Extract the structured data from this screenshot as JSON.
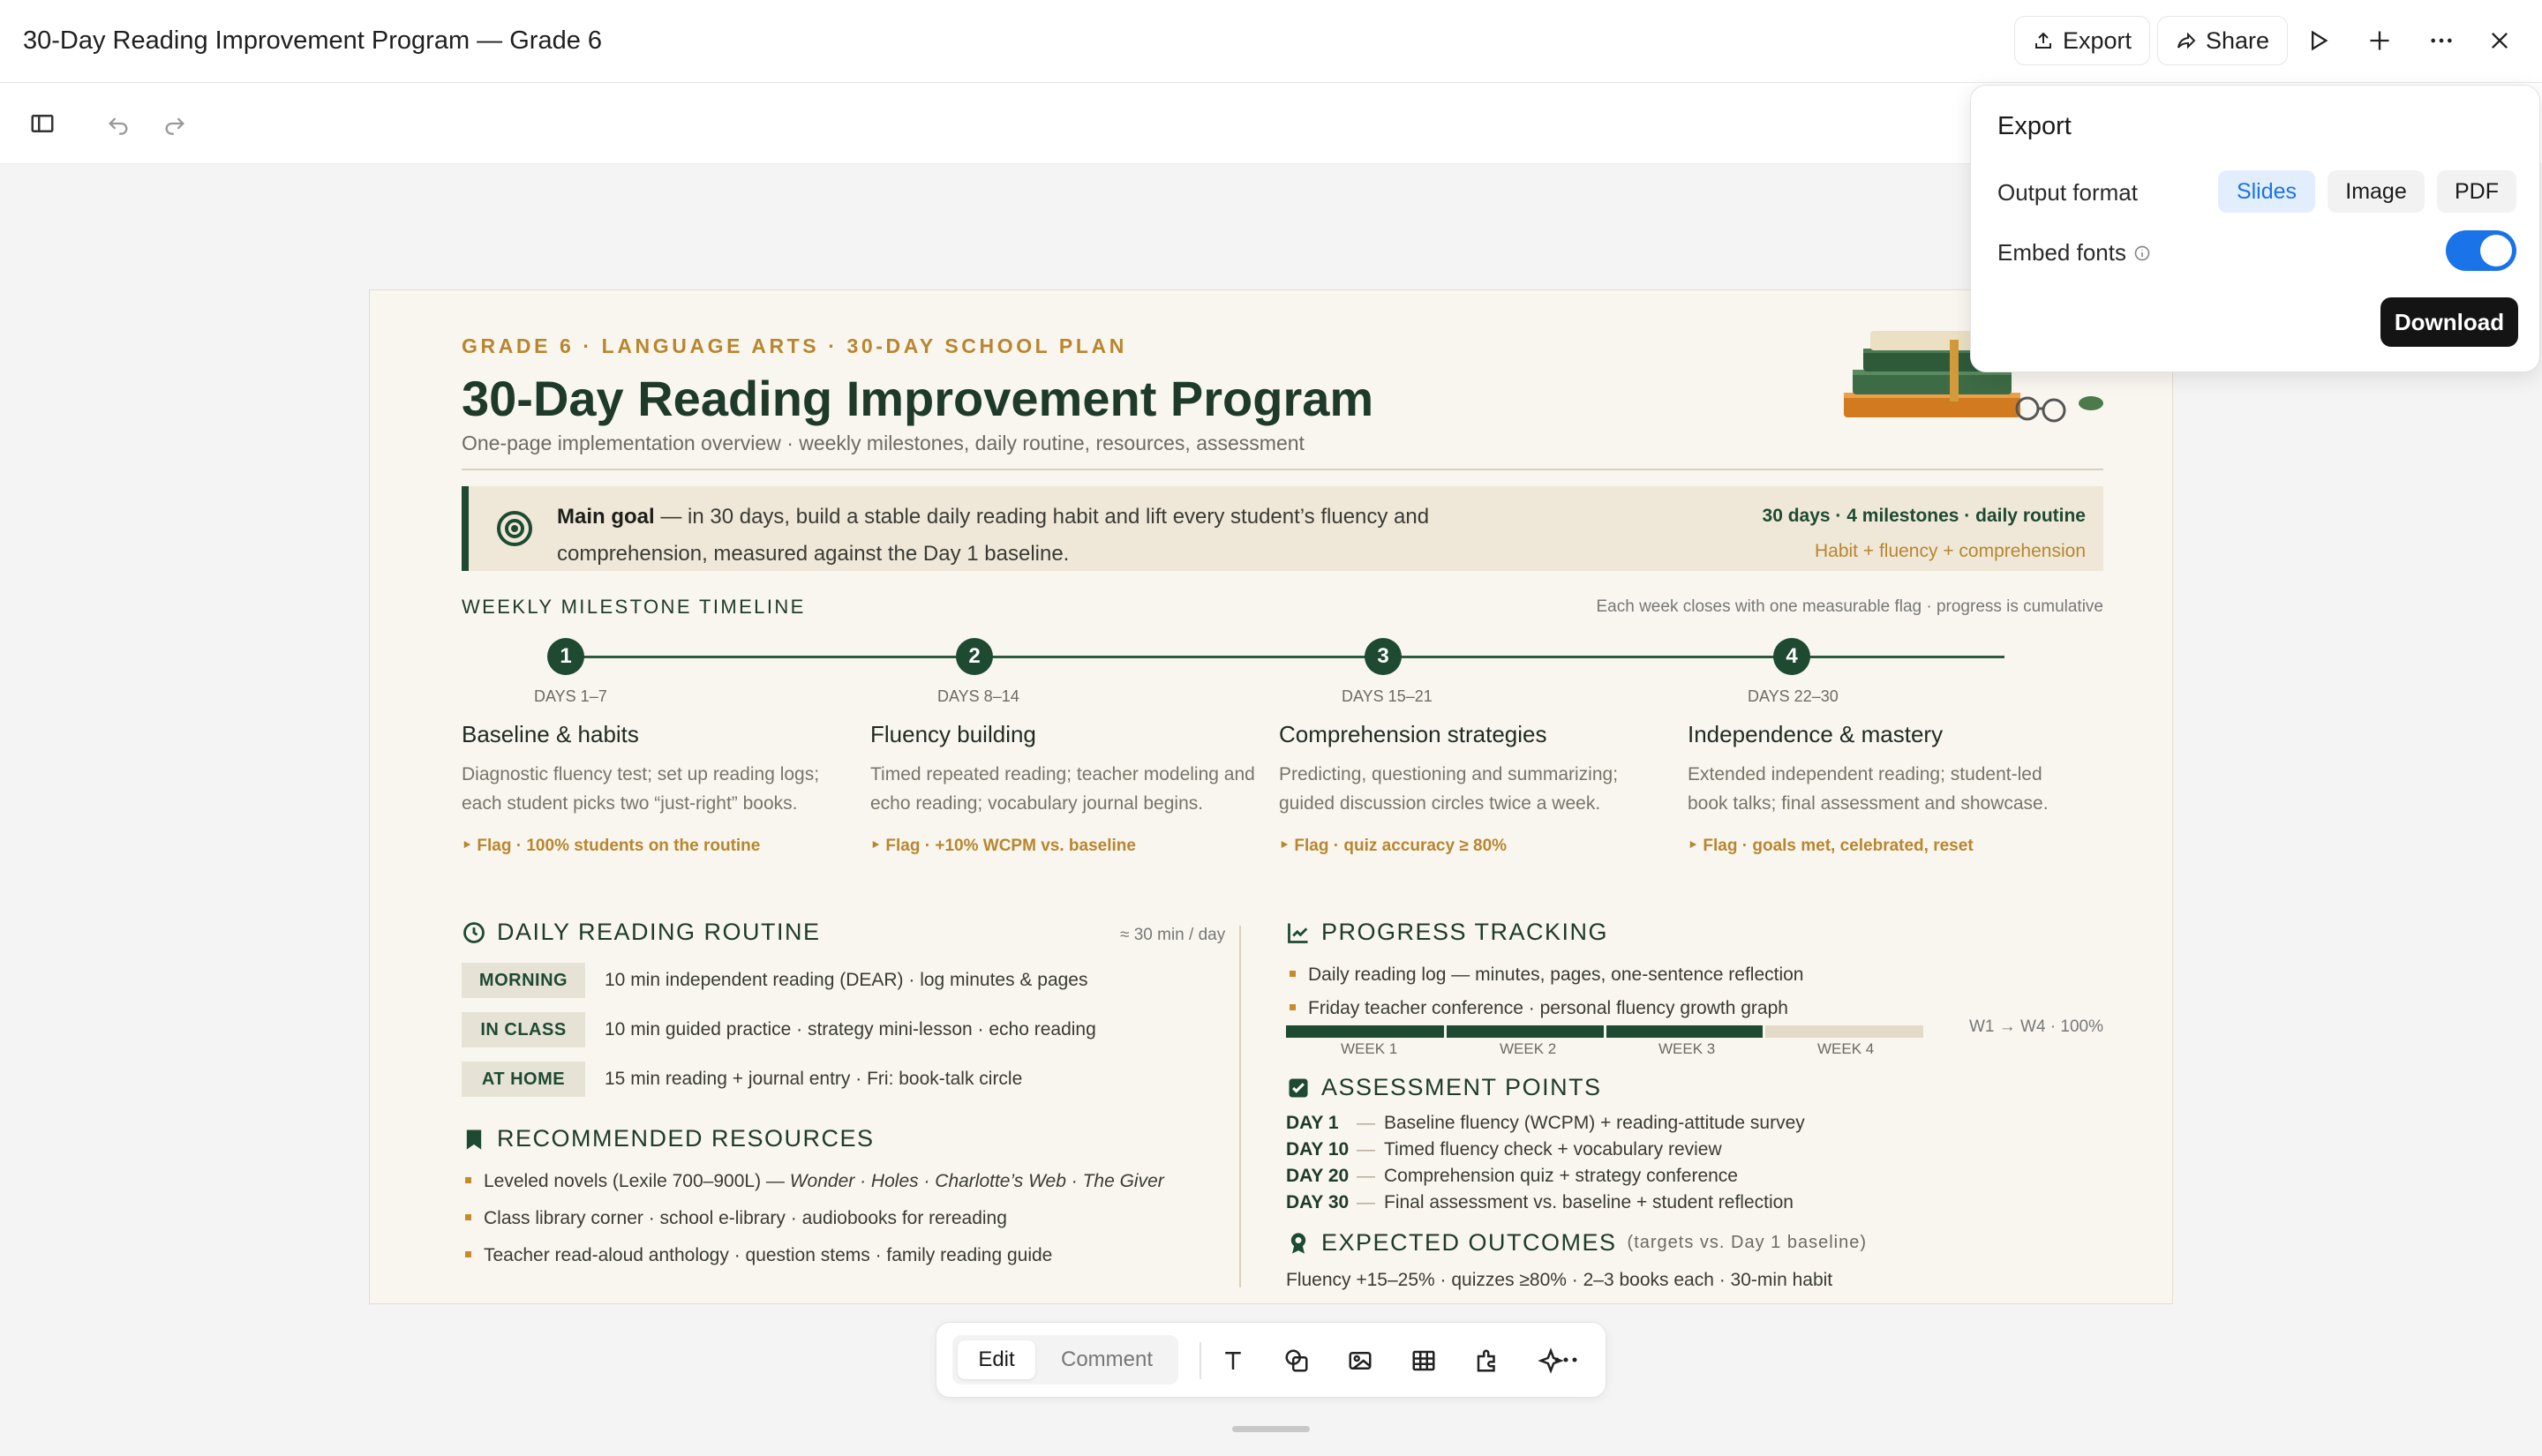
{
  "window": {
    "title": "30-Day Reading Improvement Program — Grade 6"
  },
  "header": {
    "export_label": "Export",
    "share_label": "Share"
  },
  "slide": {
    "eyebrow": "GRADE 6 · LANGUAGE ARTS · 30-DAY SCHOOL PLAN",
    "title": "30-Day Reading Improvement Program",
    "subtitle": "One-page implementation overview · weekly milestones, daily routine, resources, assessment",
    "goal": {
      "label": "Main goal",
      "text": " — in 30 days, build a stable daily reading habit and lift every student’s fluency and comprehension, measured against the Day 1 baseline.",
      "right_line1": "30 days · 4 milestones · daily routine",
      "right_line2": "Habit + fluency + comprehension"
    },
    "timeline": {
      "label": "WEEKLY MILESTONE TIMELINE",
      "note": "Each week closes with one measurable flag · progress is cumulative",
      "milestones": [
        {
          "num": "1",
          "days": "DAYS 1–7",
          "title": "Baseline & habits",
          "desc": "Diagnostic fluency test; set up reading logs; each student picks two “just-right” books.",
          "flag": "‣  Flag · 100% students on the routine"
        },
        {
          "num": "2",
          "days": "DAYS 8–14",
          "title": "Fluency building",
          "desc": "Timed repeated reading; teacher modeling and echo reading; vocabulary journal begins.",
          "flag": "‣  Flag · +10% WCPM vs. baseline"
        },
        {
          "num": "3",
          "days": "DAYS 15–21",
          "title": "Comprehension strategies",
          "desc": "Predicting, questioning and summarizing; guided discussion circles twice a week.",
          "flag": "‣  Flag · quiz accuracy ≥ 80%"
        },
        {
          "num": "4",
          "days": "DAYS 22–30",
          "title": "Independence & mastery",
          "desc": "Extended independent reading; student-led book talks; final assessment and showcase.",
          "flag": "‣  Flag · goals met, celebrated, reset"
        }
      ]
    },
    "routine": {
      "heading": "DAILY READING ROUTINE",
      "note": "≈ 30 min / day",
      "rows": [
        {
          "tag": "MORNING",
          "text": "10 min independent reading (DEAR) · log minutes & pages"
        },
        {
          "tag": "IN CLASS",
          "text": "10 min guided practice · strategy mini-lesson · echo reading"
        },
        {
          "tag": "AT HOME",
          "text": "15 min reading + journal entry · Fri: book-talk circle"
        }
      ]
    },
    "resources": {
      "heading": "RECOMMENDED RESOURCES",
      "item1_prefix": "Leveled novels (Lexile 700–900L) — ",
      "item1_titles": "Wonder · Holes · Charlotte’s Web · The Giver",
      "item2": "Class library corner · school e-library · audiobooks for rereading",
      "item3": "Teacher read-aloud anthology · question stems · family reading guide"
    },
    "progress": {
      "heading": "PROGRESS TRACKING",
      "item1": "Daily reading log — minutes, pages, one-sentence reflection",
      "item2": "Friday teacher conference · personal fluency growth graph",
      "bar_label": "W1 → W4 · 100%",
      "fill_fraction": 0.75,
      "weeks": [
        "WEEK 1",
        "WEEK 2",
        "WEEK 3",
        "WEEK 4"
      ]
    },
    "assessment": {
      "heading": "ASSESSMENT POINTS",
      "rows": [
        {
          "day": "DAY 1",
          "text": "Baseline fluency (WCPM) + reading-attitude survey"
        },
        {
          "day": "DAY 10",
          "text": "Timed fluency check + vocabulary review"
        },
        {
          "day": "DAY 20",
          "text": "Comprehension quiz + strategy conference"
        },
        {
          "day": "DAY 30",
          "text": "Final assessment vs. baseline + student reflection"
        }
      ]
    },
    "outcomes": {
      "heading": "EXPECTED OUTCOMES",
      "heading_note": "(targets vs. Day 1 baseline)",
      "text": "Fluency +15–25% · quizzes ≥80% · 2–3 books each · 30-min habit"
    }
  },
  "export_popover": {
    "title": "Export",
    "format_label": "Output format",
    "formats": [
      "Slides",
      "Image",
      "PDF"
    ],
    "selected_format": "Slides",
    "embed_fonts_label": "Embed fonts",
    "embed_fonts_on": true,
    "download_label": "Download"
  },
  "bottom_toolbar": {
    "edit_label": "Edit",
    "comment_label": "Comment"
  },
  "colors": {
    "accent_green": "#1e4a32",
    "accent_gold": "#b8862e",
    "accent_blue": "#1a73e8"
  }
}
